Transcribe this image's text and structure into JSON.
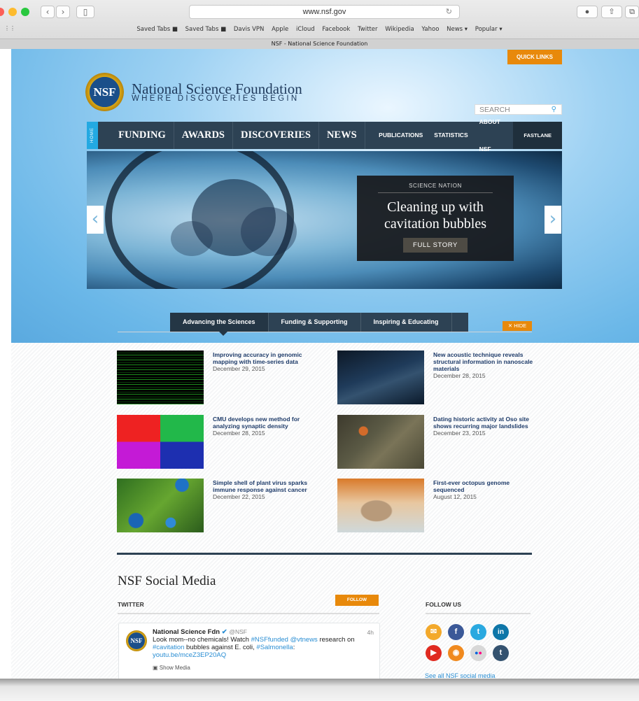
{
  "browser": {
    "url": "www.nsf.gov",
    "tab_title": "NSF - National Science Foundation",
    "bookmarks": [
      "Saved Tabs ■",
      "Saved Tabs ■",
      "Davis VPN",
      "Apple",
      "iCloud",
      "Facebook",
      "Twitter",
      "Wikipedia",
      "Yahoo",
      "News ▾",
      "Popular ▾"
    ]
  },
  "header": {
    "logo_text": "NSF",
    "title": "National Science Foundation",
    "tagline": "WHERE DISCOVERIES BEGIN",
    "quick_links": "QUICK LINKS",
    "search_placeholder": "SEARCH"
  },
  "nav": {
    "home": "HOME",
    "primary": [
      "FUNDING",
      "AWARDS",
      "DISCOVERIES",
      "NEWS"
    ],
    "secondary": [
      "PUBLICATIONS",
      "STATISTICS",
      "ABOUT NSF"
    ],
    "fastlane": "FASTLANE"
  },
  "slide": {
    "kicker": "SCIENCE NATION",
    "headline_line1": "Cleaning up with",
    "headline_line2": "cavitation bubbles",
    "button": "FULL STORY"
  },
  "tabs": {
    "items": [
      "Advancing the Sciences",
      "Funding & Supporting",
      "Inspiring & Educating"
    ],
    "hide": "HIDE"
  },
  "stories": [
    {
      "title": "Improving accuracy in genomic mapping with time-series data",
      "date": "December 29, 2015"
    },
    {
      "title": "New acoustic technique reveals structural information in nanoscale materials",
      "date": "December 28, 2015"
    },
    {
      "title": "CMU develops new method for analyzing synaptic density",
      "date": "December 28, 2015"
    },
    {
      "title": "Dating historic activity at Oso site shows recurring major landslides",
      "date": "December 23, 2015"
    },
    {
      "title": "Simple shell of plant virus sparks immune response against cancer",
      "date": "December 22, 2015"
    },
    {
      "title": "First-ever octopus genome sequenced",
      "date": "August 12, 2015"
    }
  ],
  "social": {
    "heading": "NSF Social Media",
    "twitter_heading": "TWITTER",
    "follow_button": "FOLLOW",
    "follow_us": "FOLLOW US",
    "see_all": "See all NSF social media",
    "tweet": {
      "name": "National Science Fdn",
      "handle": "@NSF",
      "time": "4h",
      "text_a": "Look mom--no chemicals! Watch ",
      "tag1": "#NSFfunded",
      "mention": "@vtnews",
      "text_b": " research on ",
      "tag2": "#cavitation",
      "text_c": " bubbles against E. coli, ",
      "tag3": "#Salmonella",
      "text_d": ":",
      "link": "youtu.be/mceZ3EP20AQ",
      "media": "Show Media"
    }
  }
}
